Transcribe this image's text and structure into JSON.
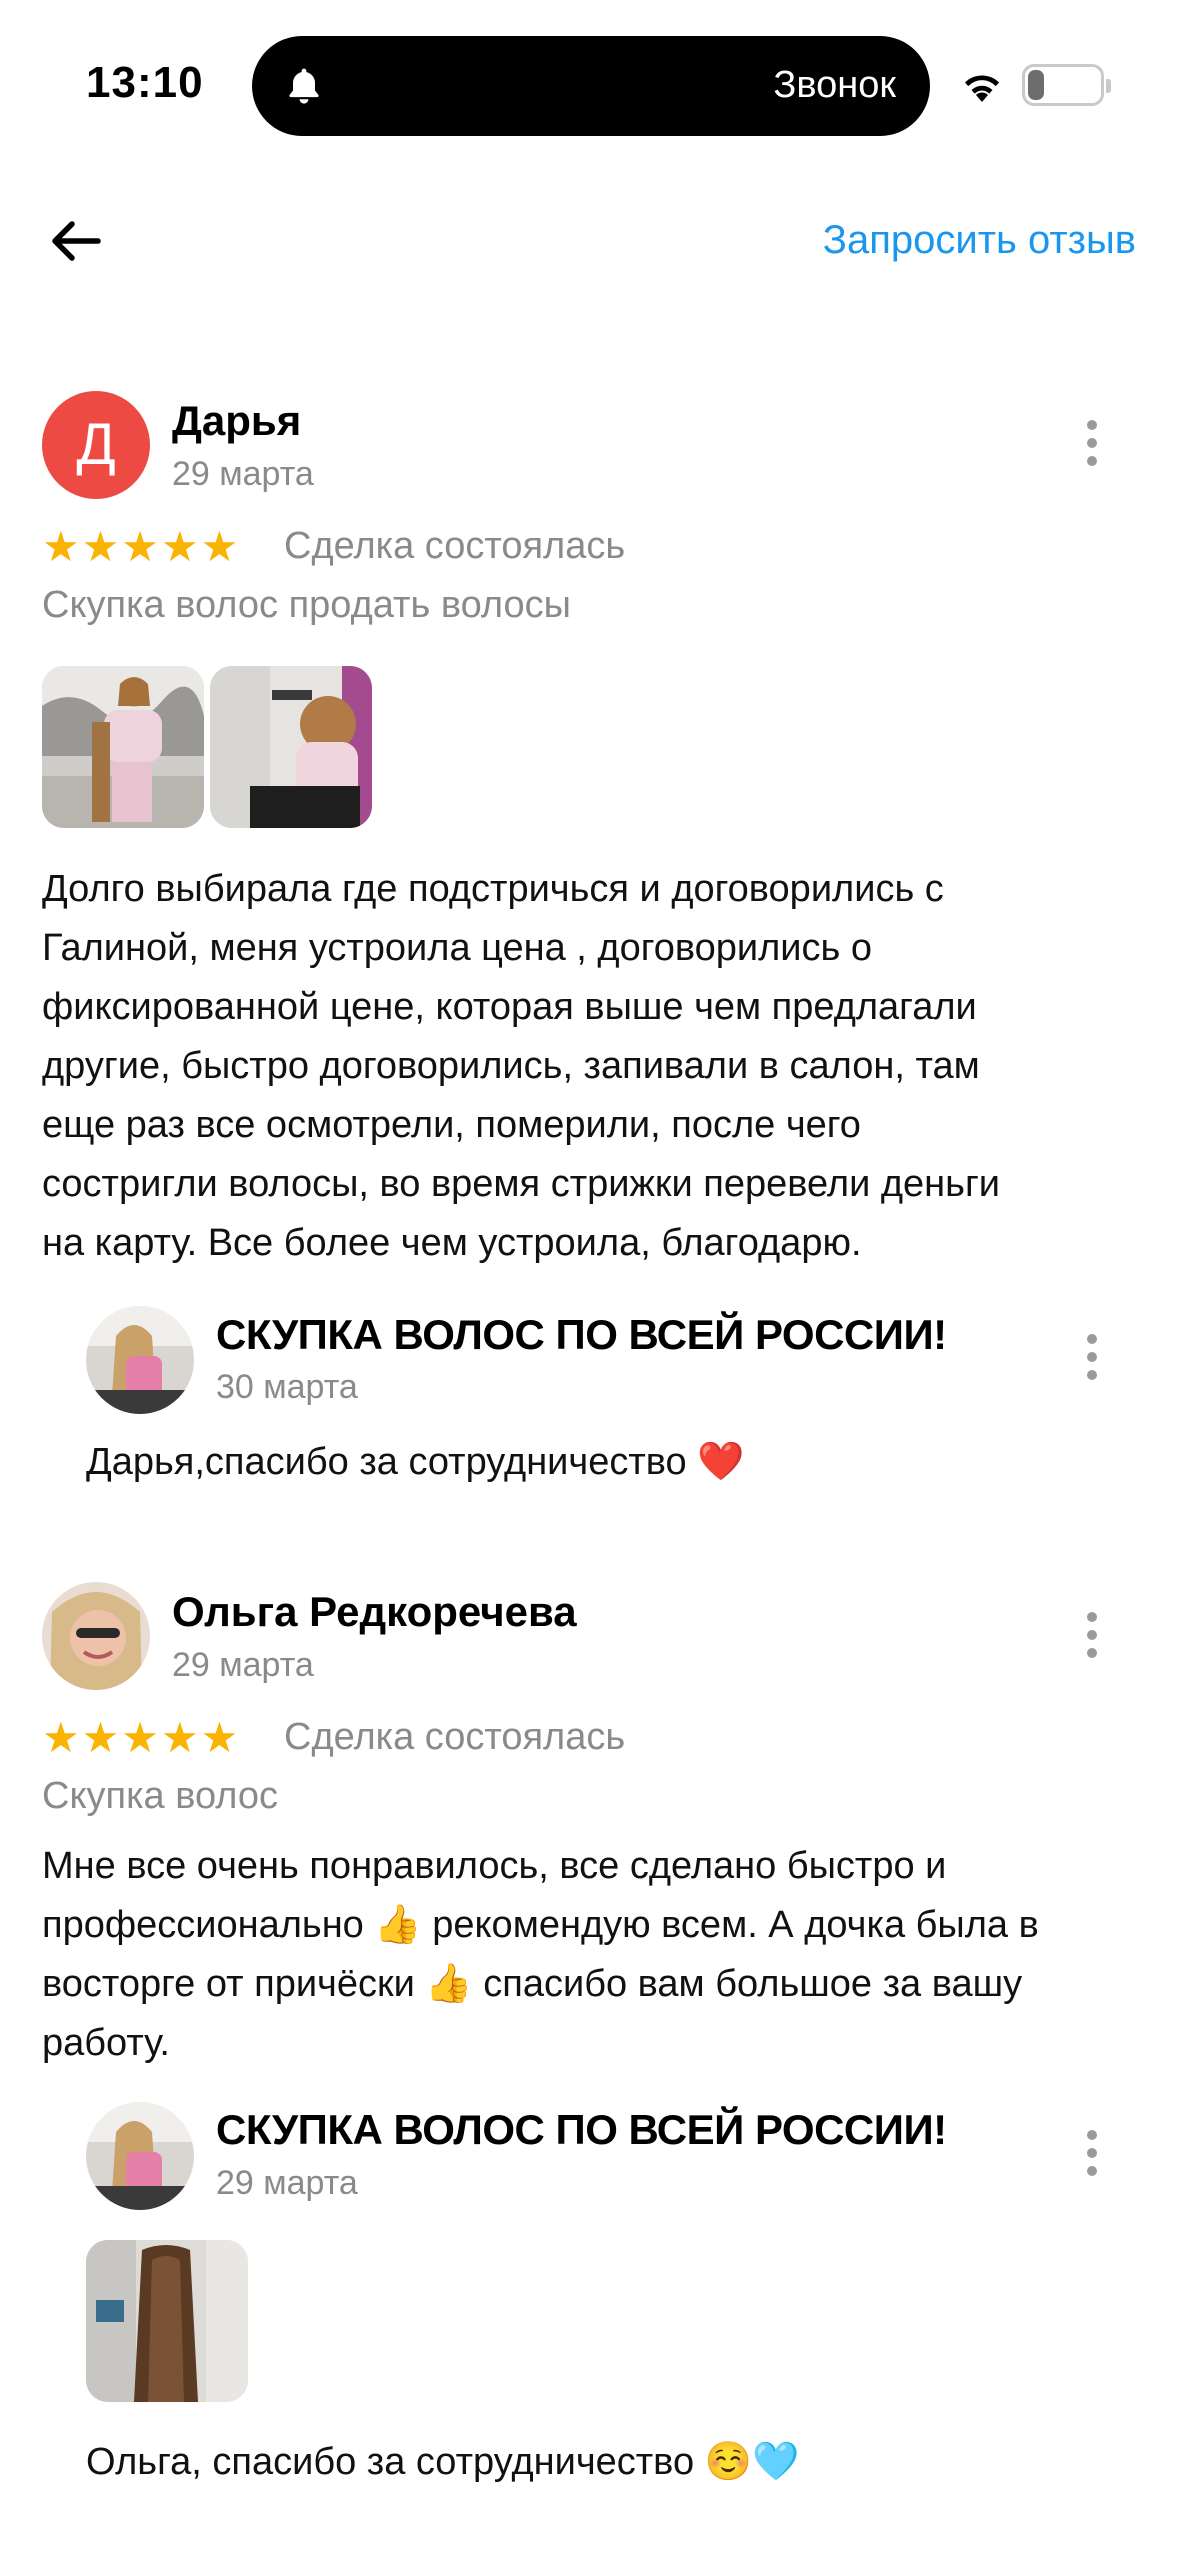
{
  "status_bar": {
    "time": "13:10",
    "call_label": "Звонок",
    "battery_level": "21",
    "battery_fraction": 0.21
  },
  "header": {
    "back_icon": "arrow-left-icon",
    "request_review_label": "Запросить отзыв"
  },
  "reviews": [
    {
      "author": "Дарья",
      "avatar_letter": "Д",
      "avatar_color": "#ee4a44",
      "date": "29 марта",
      "rating": 5,
      "stars": "★★★★★",
      "deal_status": "Сделка состоялась",
      "service": "Скупка волос продать волосы",
      "text_lines": [
        "Долго выбирала где подстричься и договорились с",
        "Галиной, меня устроила цена , договорились о",
        "фиксированной цене, которая выше чем предлагали",
        "другие, быстро договорились, запивали в салон, там",
        "еще раз все осмотрели, померили, после чего",
        "состригли волосы, во время стрижки перевели деньги",
        "на карту. Все более чем устроила, благодарю."
      ],
      "reply": {
        "author": "СКУПКА ВОЛОС ПО ВСЕЙ РОССИИ!",
        "date": "30 марта",
        "text": "Дарья,спасибо за сотрудничество ❤️"
      }
    },
    {
      "author": "Ольга Редкоречева",
      "date": "29 марта",
      "rating": 5,
      "stars": "★★★★★",
      "deal_status": "Сделка состоялась",
      "service": "Скупка волос",
      "text_lines": [
        "Мне все очень понравилось, все сделано быстро и",
        "профессионально 👍 рекомендую всем. А дочка была в",
        "восторге от причёски 👍 спасибо вам большое за вашу",
        "работу."
      ],
      "reply": {
        "author": "СКУПКА ВОЛОС ПО ВСЕЙ РОССИИ!",
        "date": "29 марта",
        "text": "Ольга, спасибо за сотрудничество ☺️🩵"
      }
    }
  ],
  "colors": {
    "accent": "#1a96ef",
    "stars": "#f9b300",
    "secondary_text": "#8a8a8a"
  }
}
